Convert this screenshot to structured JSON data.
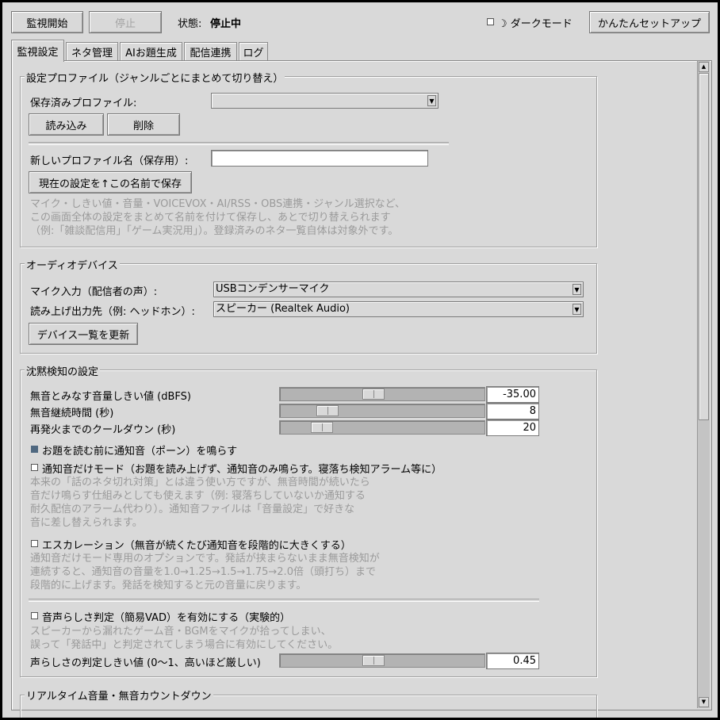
{
  "toolbar": {
    "start_label": "監視開始",
    "stop_label": "停止",
    "status_label": "状態:",
    "status_value": "停止中",
    "dark_mode_label": "☽ ダークモード",
    "dark_mode_checked": false,
    "setup_label": "かんたんセットアップ"
  },
  "tabs": [
    {
      "label": "監視設定",
      "active": true
    },
    {
      "label": "ネタ管理",
      "active": false
    },
    {
      "label": "AIお題生成",
      "active": false
    },
    {
      "label": "配信連携",
      "active": false
    },
    {
      "label": "ログ",
      "active": false
    }
  ],
  "profile": {
    "title": "設定プロファイル（ジャンルごとにまとめて切り替え）",
    "saved_label": "保存済みプロファイル:",
    "saved_value": "",
    "load_label": "読み込み",
    "delete_label": "削除",
    "new_name_label": "新しいプロファイル名（保存用）:",
    "new_name_value": "",
    "save_label": "現在の設定を↑この名前で保存",
    "help": [
      "マイク・しきい値・音量・VOICEVOX・AI/RSS・OBS連携・ジャンル選択など、",
      "この画面全体の設定をまとめて名前を付けて保存し、あとで切り替えられます",
      "（例:「雑談配信用」「ゲーム実況用」）。登録済みのネタ一覧自体は対象外です。"
    ]
  },
  "audio": {
    "title": "オーディオデバイス",
    "mic_label": "マイク入力（配信者の声）:",
    "mic_value": "USBコンデンサーマイク",
    "output_label": "読み上げ出力先（例: ヘッドホン）:",
    "output_value": "スピーカー (Realtek Audio)",
    "refresh_label": "デバイス一覧を更新"
  },
  "silence": {
    "title": "沈黙検知の設定",
    "threshold_label": "無音とみなす音量しきい値 (dBFS)",
    "threshold_value": "-35.00",
    "threshold_fraction": 0.45,
    "duration_label": "無音継続時間 (秒)",
    "duration_value": "8",
    "duration_fraction": 0.2,
    "cooldown_label": "再発火までのクールダウン (秒)",
    "cooldown_value": "20",
    "cooldown_fraction": 0.17,
    "chime_label": "お題を読む前に通知音（ポーン）を鳴らす",
    "chime_checked": true,
    "notify_only_label": "通知音だけモード（お題を読み上げず、通知音のみ鳴らす。寝落ち検知アラーム等に）",
    "notify_only_checked": false,
    "notify_only_help": [
      "本来の「話のネタ切れ対策」とは違う使い方ですが、無音時間が続いたら",
      "音だけ鳴らす仕組みとしても使えます（例: 寝落ちしていないか通知する",
      "耐久配信のアラーム代わり）。通知音ファイルは「音量設定」で好きな",
      "音に差し替えられます。"
    ],
    "escalation_label": "エスカレーション（無音が続くたび通知音を段階的に大きくする）",
    "escalation_checked": false,
    "escalation_help": [
      "通知音だけモード専用のオプションです。発話が挟まらないまま無音検知が",
      "連続すると、通知音の音量を1.0→1.25→1.5→1.75→2.0倍（頭打ち）まで",
      "段階的に上げます。発話を検知すると元の音量に戻ります。"
    ],
    "vad_label": "音声らしさ判定（簡易VAD）を有効にする（実験的）",
    "vad_checked": false,
    "vad_help": [
      "スピーカーから漏れたゲーム音・BGMをマイクが拾ってしまい、",
      "誤って「発話中」と判定されてしまう場合に有効にしてください。"
    ],
    "vad_threshold_label": "声らしさの判定しきい値 (0〜1、高いほど厳しい)",
    "vad_threshold_value": "0.45",
    "vad_threshold_fraction": 0.45
  },
  "realtime": {
    "title": "リアルタイム音量・無音カウントダウン"
  }
}
